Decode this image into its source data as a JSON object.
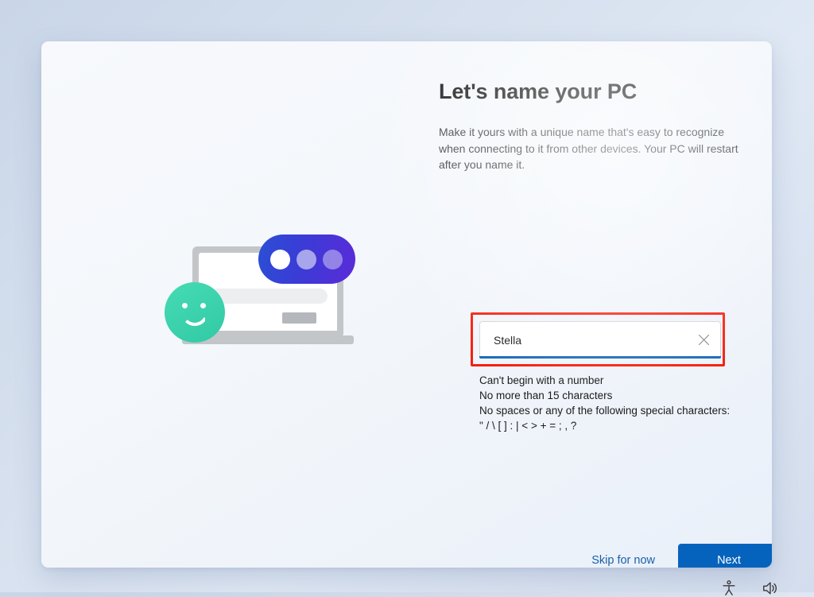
{
  "screen": {
    "name": "windows-oobe-name-your-pc",
    "background_color": "#d3dded",
    "card_background": "#f4f7fb",
    "accent_color": "#0663bd",
    "annotation_color": "#f61f10"
  },
  "main": {
    "title": "Let's name your PC",
    "description": "Make it yours with a unique name that's easy to recognize when connecting to it from other devices. Your PC will restart after you name it."
  },
  "name_field": {
    "value": "Stella",
    "placeholder": "",
    "clear_icon": "close-icon",
    "focus_underline_color": "#1a6bb8",
    "highlight_border_color": "#f61f10"
  },
  "validation_rules": [
    "Can't begin with a number",
    "No more than 15 characters",
    "No spaces or any of the following special characters:",
    "\" / \\ [ ] : | < > + = ; , ?"
  ],
  "footer": {
    "skip_label": "Skip for now",
    "next_label": "Next"
  },
  "illustration": {
    "name": "laptop-chat-smiley-illustration",
    "pill_gradient_start": "#2b4fd4",
    "pill_gradient_end": "#5a2bd8",
    "smiley_color": "#32c9a6",
    "laptop_color": "#c3c6c9"
  },
  "system_tray": {
    "items": [
      {
        "icon": "accessibility-icon"
      },
      {
        "icon": "volume-icon"
      }
    ]
  }
}
